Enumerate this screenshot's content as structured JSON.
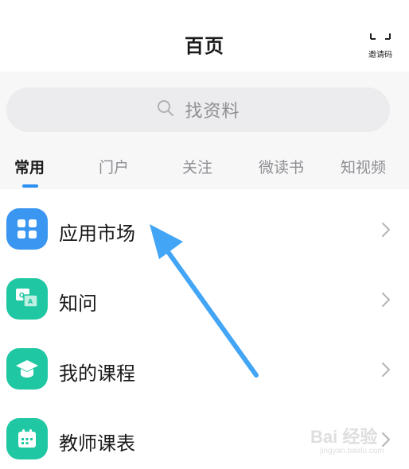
{
  "header": {
    "title": "百页",
    "invite_label": "邀请码",
    "invite_icon": "scan-frame-icon"
  },
  "search": {
    "placeholder": "找资料",
    "icon": "search-icon"
  },
  "tabs": [
    {
      "label": "常用",
      "active": true
    },
    {
      "label": "门户",
      "active": false
    },
    {
      "label": "关注",
      "active": false
    },
    {
      "label": "微读书",
      "active": false
    },
    {
      "label": "知视频",
      "active": false
    }
  ],
  "accent_color": "#2b8ff2",
  "list": [
    {
      "label": "应用市场",
      "icon": "grid-apps-icon",
      "color": "#3a96f0"
    },
    {
      "label": "知问",
      "icon": "qa-icon",
      "color": "#1fc7a2"
    },
    {
      "label": "我的课程",
      "icon": "graduation-cap-icon",
      "color": "#1fc7a2"
    },
    {
      "label": "教师课表",
      "icon": "calendar-icon",
      "color": "#1fc7a2"
    }
  ],
  "annotation": {
    "arrow_color": "#42a5f5"
  },
  "watermark": {
    "text": "Bai 经验",
    "sub": "jingyan.baidu.com"
  }
}
